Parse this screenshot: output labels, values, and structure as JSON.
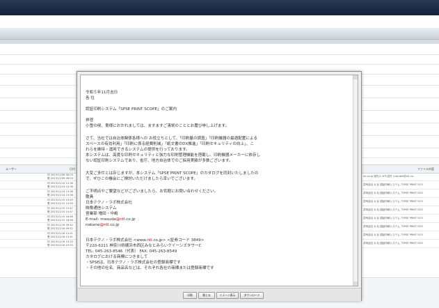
{
  "table": {
    "headers": {
      "user": "ユーザー",
      "date": "日付",
      "filename": "ファイル内容"
    },
    "rows": [
      {
        "d1": "印 2023/11/06 06:03",
        "d2": "受 2023/11/06 06:03",
        "file": "ntl.co.jp 宛先人 NTL送付 <randsh@ntl.co."
      },
      {
        "d1": "印 2023/11/14 15:36",
        "d2": "受 2023/11/14 15:36",
        "file": "共有会社 & 社 認証印刷システム「SPSE PRINT SCO"
      },
      {
        "d1": "印 2023/11/14 15:36",
        "d2": "受 2023/11/14 15:36",
        "file": "共有会社 & 社 認証印刷システム「SPSE PRINT SCO"
      },
      {
        "d1": "印 2023/11/15 15:49",
        "d2": "受 2023/11/15 15:49",
        "file": "共有会社 & 社 認証印刷システム「SPSE PRINT SCO"
      },
      {
        "d1": "印 2023/11/15 15:47",
        "d2": "受 2023/11/15 15:47",
        "file": "共有会社 & 社 認証印刷システム「SPSE PRINT SCO"
      },
      {
        "d1": "印 2023/11/15 16:46",
        "d2": "受 2023/11/15 16:46",
        "file": "共有会社 & 社 認証印刷システム「SPSE PRINT SCO"
      },
      {
        "d1": "印 2023/11/16 09:42",
        "d2": "受 2023/11/16 09:42",
        "file": "共有会社 & 社 認証印刷システム「SPSE PRINT SCO"
      },
      {
        "d1": "印 2023/11/16 15:41",
        "d2": "受 2023/11/16 15:41",
        "file": "共有会社 & 社 認証印刷システム「SPSE PRINT SCO"
      },
      {
        "d1": "印 2023/11/16 15:33",
        "d2": "受 2023/11/16 15:33",
        "file": "共有会社 & 社 認証印刷システム「SPSE PRINT SCO"
      }
    ]
  },
  "dialog": {
    "lines": {
      "date": "令和５年11月吉日",
      "salutation": "各 位",
      "subject": "認証印刷システム「SPSE PRINT SCOPE」のご案内",
      "greeting1": "拝啓",
      "greeting2": "小雪の候、貴様におかれましては、ますますご清栄のこととお慶び申し上げます。",
      "p1a": "さて、当社では自治体関係各様への お役立ちとして、「印刷量の調査」「印刷機器の最適配置による",
      "p1b": "スペースの有効利用」「印刷に係る経費削減」「紙文書のDX推進」「印刷セキュリティの向上」、こ",
      "p1c": "れらを維持・運用できるシステムの提供を行っております。",
      "p2a": "本システムは、高度な印刷セキュリティと強力な印刷管理機能を搭載し、印刷機器メーカーに依存し",
      "p2b": "ない認証印刷システムであり、省庁、地方自治体でのご採用実績が多数ございます。",
      "p3a": "大変ご多忙とは存じますが、本システム「SPSE PRINT SCOPE」のカタログを同封いたしましたの",
      "p3b": "で、ぜひこの機会にご検討いただけましたら幸いでございます。",
      "p4": "ご不明点やご要望などがございましたら、お気軽にお問い合わせください。",
      "closing": "敬具",
      "company": "日本テクノ・ラボ株式会社",
      "dept": "映像通信システム",
      "person": "営業部 増田・中嶋",
      "email_prefix": "E-mail: masuda",
      "email_domain": "@ntl",
      "email_suffix": ".co.jp",
      "email2_prefix": "nakane",
      "email2_domain": "@ntl",
      "email2_suffix": ".co.jp",
      "sig_prefix": "日本テクノ・ラボ株式会社 <www.",
      "sig_ntl": "ntl",
      "sig_suffix": ".co.jp> <証券コード 3849>",
      "address": "〒220-6211 神奈川県横浜市西区みなとみらいクイーンズタワーC",
      "tel": "TEL: 045-263-8546（代表） FAX: 045-263-8549",
      "trademark_head": "カタログにおける商標につきまして",
      "tm1": "・SPSEは、日本テクノ・ラボ株式会社の登録商標です",
      "tm2": "・その他の社名、商品名などは、それぞれ各社の商標または登録商標です"
    },
    "buttons": {
      "print": "印刷",
      "close": "閉じる",
      "image": "イメージ表示",
      "download": "ダウンロード"
    }
  }
}
